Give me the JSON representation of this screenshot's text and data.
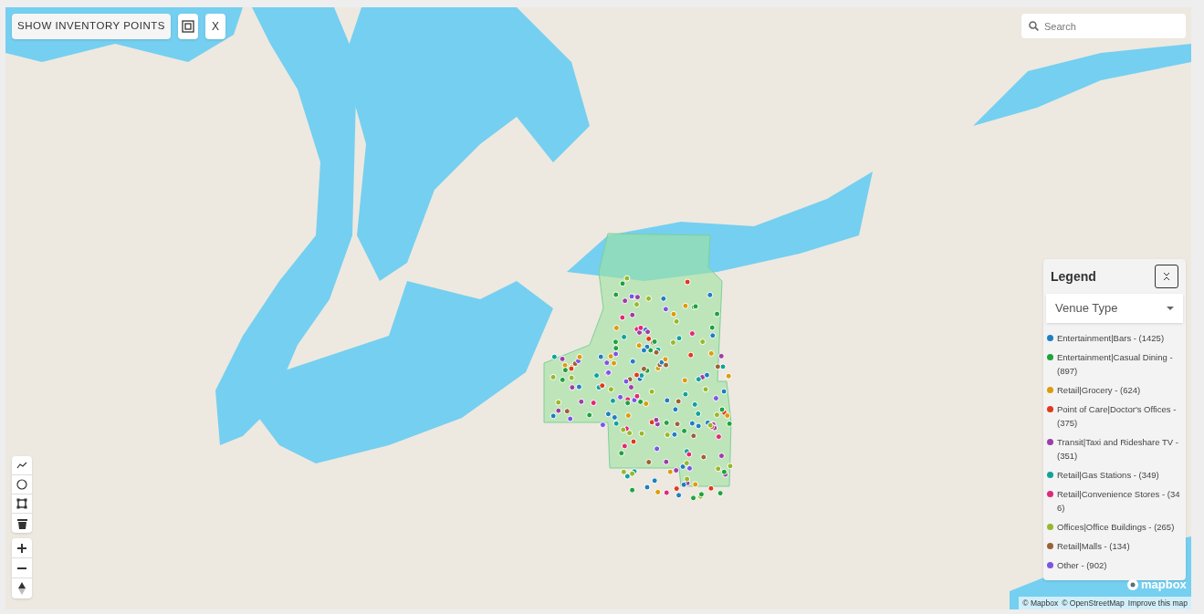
{
  "toolbar": {
    "show_button": "SHOW INVENTORY POINTS",
    "close_button": "X"
  },
  "search": {
    "placeholder": "Search"
  },
  "legend": {
    "title": "Legend",
    "dropdown": "Venue Type",
    "items": [
      {
        "label": "Entertainment|Bars - (1425)",
        "color": "#1f7fc0"
      },
      {
        "label": "Entertainment|Casual Dining - (897)",
        "color": "#1fa33c"
      },
      {
        "label": "Retail|Grocery - (624)",
        "color": "#dc9c0c"
      },
      {
        "label": "Point of Care|Doctor's Offices - (375)",
        "color": "#df3a1c"
      },
      {
        "label": "Transit|Taxi and Rideshare TV - (351)",
        "color": "#9c3fa3"
      },
      {
        "label": "Retail|Gas Stations - (349)",
        "color": "#10a39a"
      },
      {
        "label": "Retail|Convenience Stores - (346)",
        "color": "#e02a76"
      },
      {
        "label": "Offices|Office Buildings - (265)",
        "color": "#98b82a"
      },
      {
        "label": "Retail|Malls - (134)",
        "color": "#9a6234"
      },
      {
        "label": "Other - (902)",
        "color": "#7b55e2"
      }
    ]
  },
  "attribution": {
    "logo": "mapbox",
    "links": [
      "© Mapbox",
      "© OpenStreetMap",
      "Improve this map"
    ]
  }
}
